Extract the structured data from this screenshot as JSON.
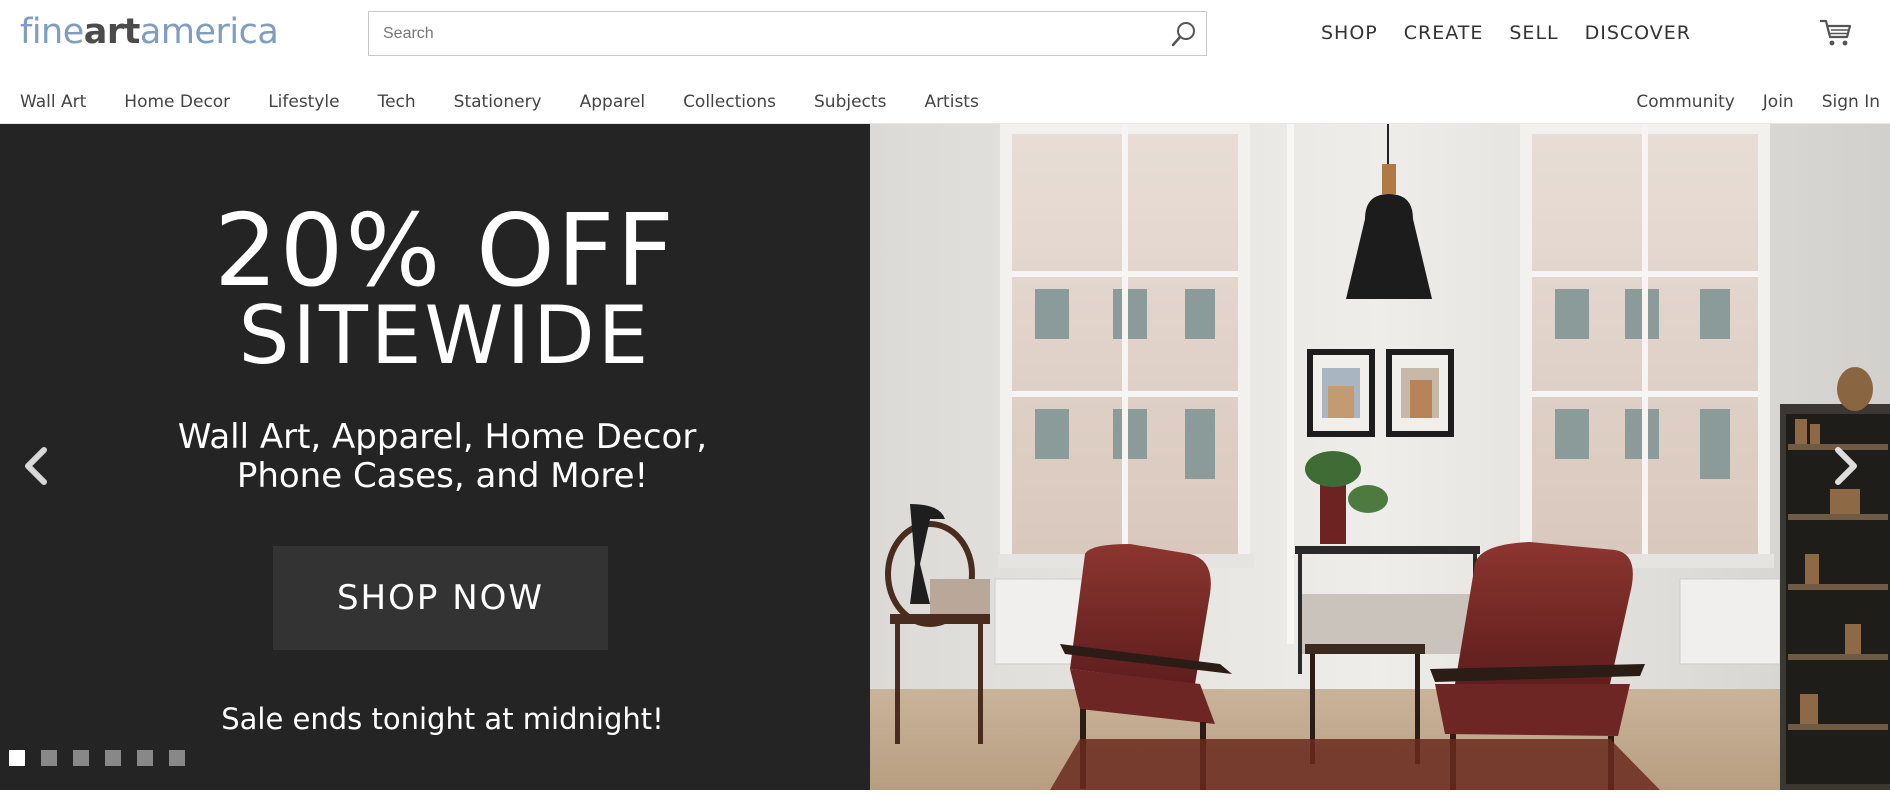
{
  "header": {
    "logo": {
      "part1": "fine",
      "part2": "art",
      "part3": "america"
    },
    "search": {
      "placeholder": "Search",
      "value": ""
    },
    "main_nav": [
      "SHOP",
      "CREATE",
      "SELL",
      "DISCOVER"
    ]
  },
  "sub_nav": {
    "left": [
      "Wall Art",
      "Home Decor",
      "Lifestyle",
      "Tech",
      "Stationery",
      "Apparel",
      "Collections",
      "Subjects",
      "Artists"
    ],
    "right": [
      "Community",
      "Join",
      "Sign In"
    ],
    "active": "Stationery"
  },
  "hero": {
    "headline_1": "20% OFF",
    "headline_2": "SITEWIDE",
    "subtext_1": "Wall Art, Apparel, Home Decor,",
    "subtext_2": "Phone Cases, and More!",
    "cta": "SHOP NOW",
    "sale_note": "Sale ends tonight at midnight!",
    "slides": 6,
    "active_slide": 1
  },
  "colors": {
    "logo_blue": "#7f9cc3",
    "active_tab_underline": "#52c0c4",
    "hero_bg": "#242424"
  },
  "icons": [
    "search-icon",
    "cart-icon",
    "chevron-left-icon",
    "chevron-right-icon"
  ]
}
